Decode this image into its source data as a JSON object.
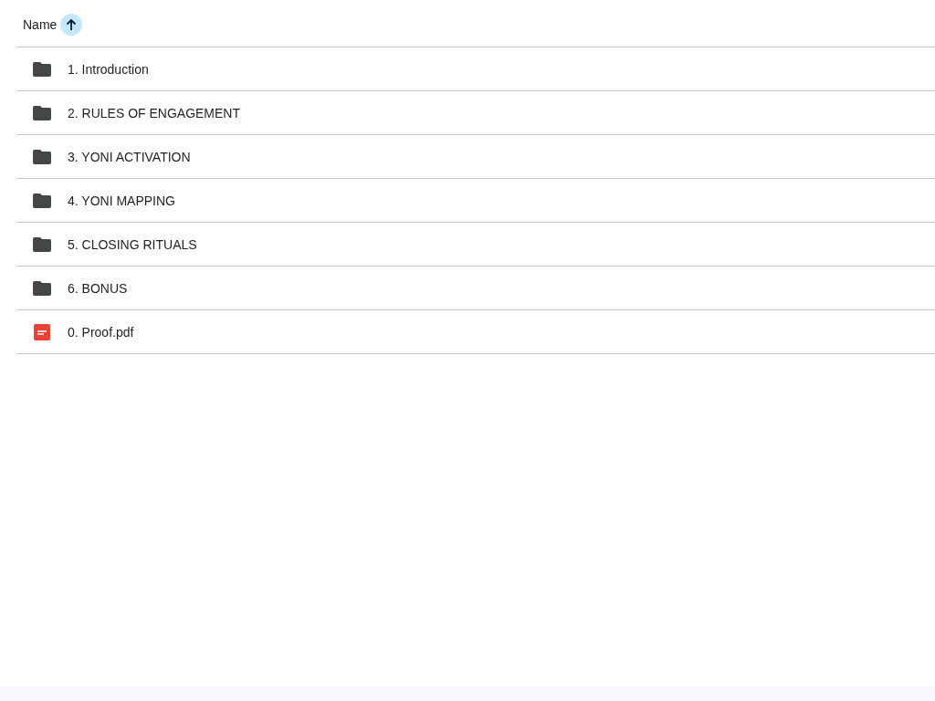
{
  "header": {
    "label": "Name",
    "sort_ascending": true
  },
  "items": [
    {
      "kind": "folder",
      "name": "1. Introduction"
    },
    {
      "kind": "folder",
      "name": "2. RULES OF ENGAGEMENT"
    },
    {
      "kind": "folder",
      "name": "3. YONI ACTIVATION"
    },
    {
      "kind": "folder",
      "name": "4. YONI MAPPING"
    },
    {
      "kind": "folder",
      "name": "5. CLOSING RITUALS"
    },
    {
      "kind": "folder",
      "name": "6. BONUS"
    },
    {
      "kind": "pdf",
      "name": "0. Proof.pdf"
    }
  ]
}
